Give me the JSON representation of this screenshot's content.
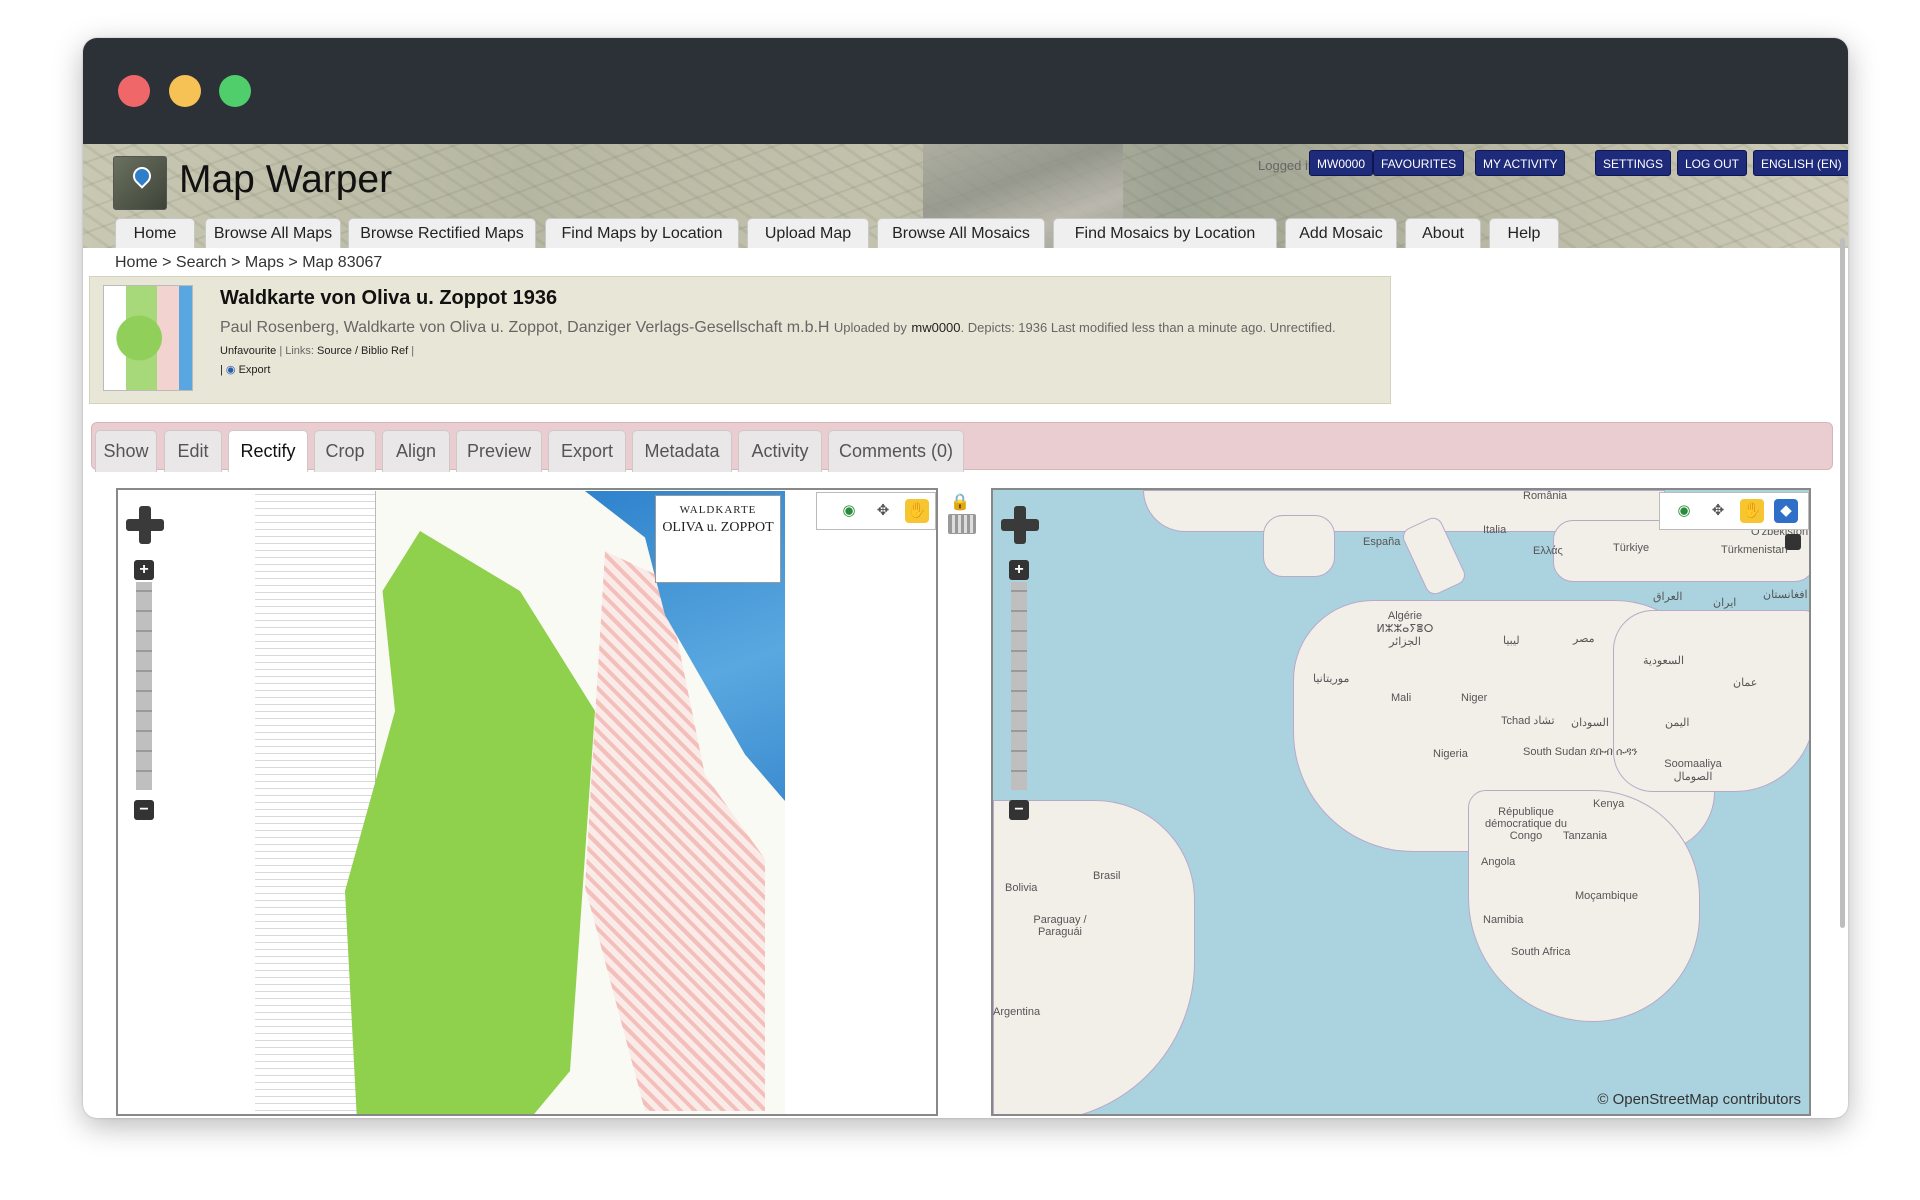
{
  "site": {
    "title": "Map Warper"
  },
  "user_bar": {
    "logged_in_as": "Logged in as:",
    "buttons": [
      "MW0000",
      "FAVOURITES",
      "MY ACTIVITY",
      "SETTINGS",
      "LOG OUT",
      "ENGLISH (EN)"
    ]
  },
  "nav": {
    "tabs": [
      "Home",
      "Browse All Maps",
      "Browse Rectified Maps",
      "Find Maps by Location",
      "Upload Map",
      "Browse All Mosaics",
      "Find Mosaics by Location",
      "Add Mosaic",
      "About",
      "Help"
    ]
  },
  "breadcrumb": {
    "items": [
      "Home",
      "Search",
      "Maps",
      "Map 83067"
    ],
    "separator": " > "
  },
  "map_info": {
    "title": "Waldkarte von Oliva u. Zoppot 1936",
    "description": "Paul Rosenberg, Waldkarte von Oliva u. Zoppot, Danziger Verlags-Gesellschaft m.b.H",
    "uploaded_by_label": "Uploaded by",
    "uploader": "mw0000",
    "details": ". Depicts: 1936 Last modified less than a minute ago. Unrectified.",
    "unfavourite": "Unfavourite",
    "links_label": " | Links: ",
    "source_link": "Source / Biblio Ref",
    "links_end": " |",
    "export_prefix": "|",
    "export": "Export"
  },
  "tabs": {
    "items": [
      "Show",
      "Edit",
      "Rectify",
      "Crop",
      "Align",
      "Preview",
      "Export",
      "Metadata",
      "Activity",
      "Comments (0)"
    ],
    "active": "Rectify"
  },
  "scan": {
    "cartouche_line1": "WALDKARTE",
    "cartouche_line2": "OLIVA u. ZOPPOT"
  },
  "osm": {
    "attribution": "© OpenStreetMap contributors",
    "labels": [
      "România",
      "Italia",
      "España",
      "Ελλάς",
      "Türkiye",
      "O'zbekiston",
      "Türkmenistan",
      "Algérie ⵍⵣⵣⴰⵢⴻⵔ الجزائر",
      "ليبيا",
      "مصر",
      "العراق",
      "ایران",
      "افغانستان",
      "السعودية",
      "موريتانيا",
      "Mali",
      "Niger",
      "Tchad تشاد",
      "السودان",
      "اليمن",
      "عمان",
      "Nigeria",
      "South Sudan ደቡብ ሱዳን",
      "Soomaaliya الصومال",
      "République démocratique du Congo",
      "Kenya",
      "Tanzania",
      "Angola",
      "Brasil",
      "Bolivia",
      "Paraguay / Paraguái",
      "Moçambique",
      "Namibia",
      "South Africa",
      "Argentina"
    ]
  },
  "colors": {
    "user_button": "#1e2a7a",
    "tab_bar": "#eacdd0",
    "info_box": "#e8e6d6",
    "ocean": "#aad3df",
    "land": "#f2efe9"
  }
}
